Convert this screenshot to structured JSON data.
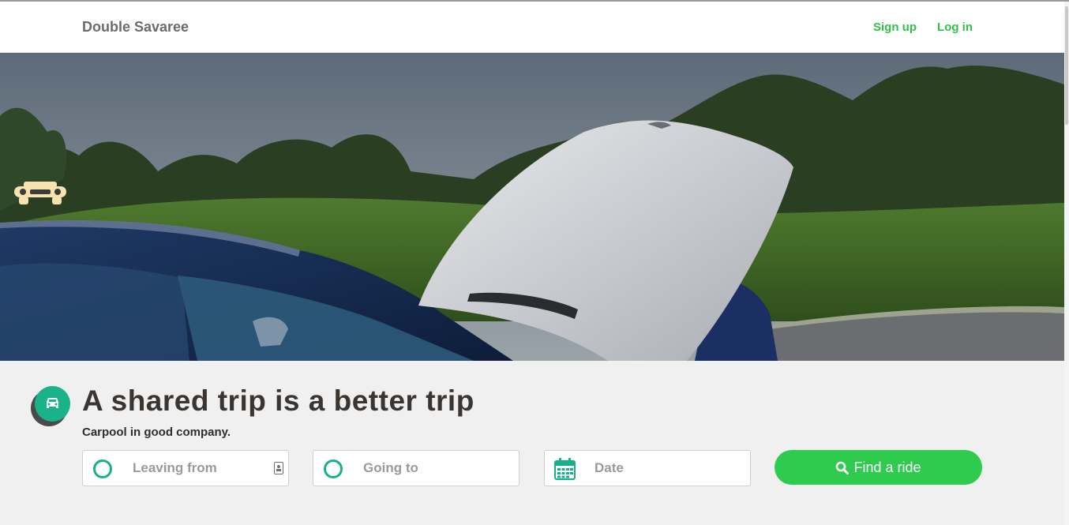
{
  "header": {
    "brand": "Double Savaree",
    "signup_label": "Sign up",
    "login_label": "Log in"
  },
  "hero": {
    "image_subject": "car with open hood on countryside road"
  },
  "main": {
    "headline": "A shared trip is a better trip",
    "subline": "Carpool in good company."
  },
  "search": {
    "leaving_placeholder": "Leaving from",
    "going_placeholder": "Going to",
    "date_placeholder": "Date",
    "find_label": "Find a ride"
  },
  "colors": {
    "accent": "#2fcb4f",
    "link": "#2fc247",
    "teal": "#19b28a",
    "headline": "#3a3530",
    "logo": "#f7e3b0"
  },
  "icons": {
    "hero_logo": "car-front-icon",
    "badge": "car-icon",
    "field_marker": "circle-ring-icon",
    "date": "calendar-icon",
    "find": "search-icon",
    "autofill": "contact-card-icon"
  }
}
